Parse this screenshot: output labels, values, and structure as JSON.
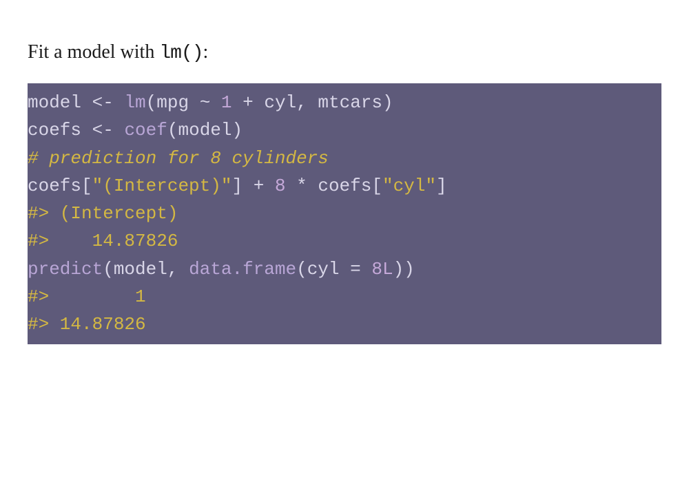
{
  "intro": {
    "prefix": "Fit a model with ",
    "code": "lm()",
    "suffix": ":"
  },
  "code": {
    "l1": {
      "t1": "model ",
      "t2": "<-",
      "t3": " ",
      "t4": "lm",
      "t5": "(",
      "t6": "mpg ",
      "t7": "~",
      "t8": " ",
      "t9": "1",
      "t10": " ",
      "t11": "+",
      "t12": " cyl",
      "t13": ",",
      "t14": " mtcars",
      "t15": ")"
    },
    "l2": {
      "t1": "coefs ",
      "t2": "<-",
      "t3": " ",
      "t4": "coef",
      "t5": "(",
      "t6": "model",
      "t7": ")"
    },
    "l3": {
      "t1": ""
    },
    "l4": {
      "t1": "# prediction for 8 cylinders"
    },
    "l5": {
      "t1": "coefs",
      "t2": "[",
      "t3": "\"(Intercept)\"",
      "t4": "]",
      "t5": " ",
      "t6": "+",
      "t7": " ",
      "t8": "8",
      "t9": " ",
      "t10": "*",
      "t11": " coefs",
      "t12": "[",
      "t13": "\"cyl\"",
      "t14": "]"
    },
    "l6": {
      "t1": "#> (Intercept) "
    },
    "l7": {
      "t1": "#>    14.87826"
    },
    "l8": {
      "t1": ""
    },
    "l9": {
      "t1": "predict",
      "t2": "(",
      "t3": "model",
      "t4": ",",
      "t5": " ",
      "t6": "data.frame",
      "t7": "(",
      "t8": "cyl ",
      "t9": "=",
      "t10": " ",
      "t11": "8",
      "t12": "L",
      "t13": ")",
      "t14": ")"
    },
    "l10": {
      "t1": "#>        1 "
    },
    "l11": {
      "t1": "#> 14.87826"
    }
  }
}
